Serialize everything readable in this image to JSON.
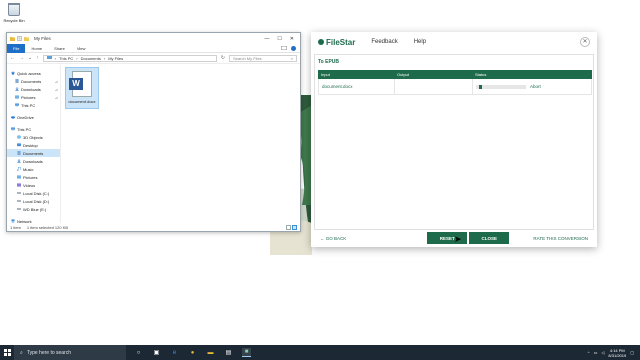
{
  "desktop": {
    "recycle_bin_label": "Recycle Bin"
  },
  "explorer": {
    "title": "My Files",
    "window_controls": {
      "minimize": "—",
      "maximize": "☐",
      "close": "✕"
    },
    "ribbon_tabs": [
      "File",
      "Home",
      "Share",
      "View"
    ],
    "address": {
      "path": [
        "This PC",
        "Documents",
        "My Files"
      ]
    },
    "search_placeholder": "Search My Files",
    "nav": {
      "quick_access": "Quick access",
      "quick_items": [
        "Documents",
        "Downloads",
        "Pictures",
        "This PC"
      ],
      "onedrive": "OneDrive",
      "this_pc": "This PC",
      "pc_items": [
        "3D Objects",
        "Desktop",
        "Documents",
        "Downloads",
        "Music",
        "Pictures",
        "Videos",
        "Local Disk (C:)",
        "Local Disk (D:)",
        "WD Blue (E:)"
      ],
      "network": "Network"
    },
    "file": {
      "name": "document.docx",
      "icon_letter": "W"
    },
    "status": {
      "count": "1 item",
      "selected": "1 item selected  120 KB"
    }
  },
  "filestar": {
    "brand": "FileStar",
    "menu": [
      "Feedback",
      "Help"
    ],
    "task_title": "To EPUB",
    "columns": [
      "Input",
      "Output",
      "Status"
    ],
    "rows": [
      {
        "input": "document.docx",
        "output": "",
        "progress": 0.02,
        "action": "Abort"
      }
    ],
    "footer": {
      "go_back": "GO BACK",
      "reset": "RESET",
      "close": "CLOSE",
      "rate": "RATE THIS CONVERSION"
    },
    "colors": {
      "accent": "#1e6b4c"
    }
  },
  "taskbar": {
    "search_placeholder": "Type here to search",
    "clock_time": "4:14 PM",
    "clock_date": "8/31/2019"
  }
}
